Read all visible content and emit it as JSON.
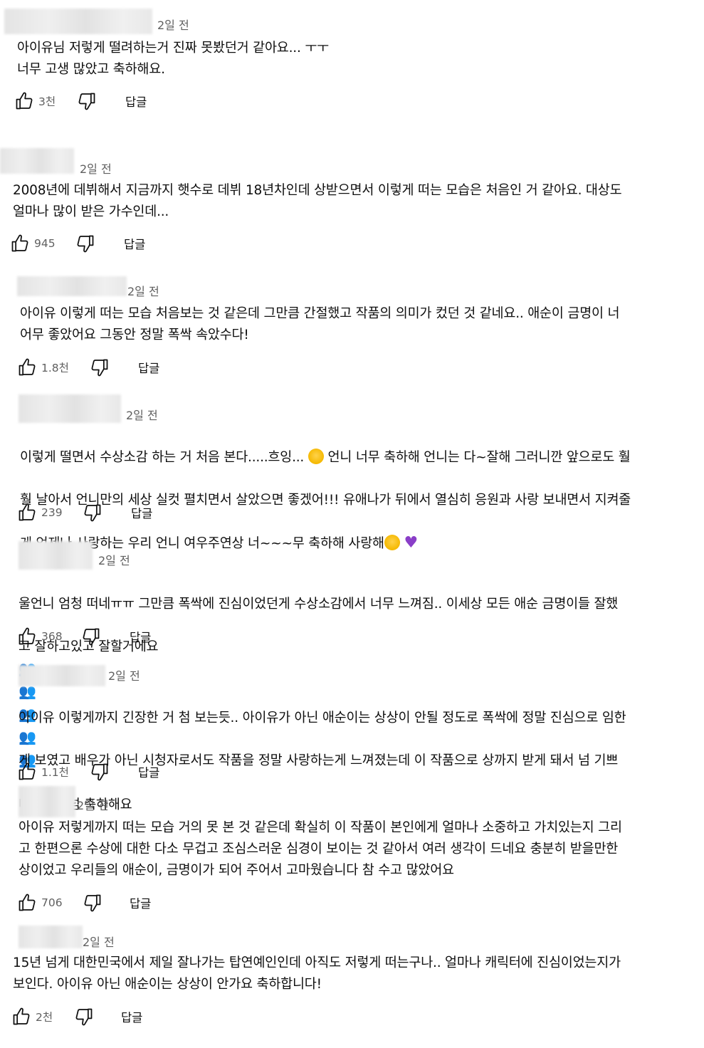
{
  "comments": [
    {
      "time": "2일 전",
      "text": "아이유님 저렇게 떨려하는거 진짜 못봤던거 같아요... ㅜㅜ\n너무 고생 많았고 축하해요.",
      "likes": "3천",
      "reply": "답글"
    },
    {
      "time": "2일 전",
      "text": "2008년에 데뷔해서 지금까지 햇수로 데뷔 18년차인데 상받으면서 이렇게 떠는 모습은 처음인 거 같아요. 대상도\n얼마나 많이 받은 가수인데...",
      "likes": "945",
      "reply": "답글"
    },
    {
      "time": "2일 전",
      "text": "아이유 이렇게 떠는 모습 처음보는 것 같은데 그만큼 간절했고 작품의 의미가 컸던 것 같네요.. 애순이 금명이 너\n어무 좋았어요 그동안 정말 폭싹 속았수다!",
      "likes": "1.8천",
      "reply": "답글"
    },
    {
      "time": "2일 전",
      "text_lines": [
        "이렇게 떨면서 수상소감 하는 거 처음 본다.....흐잉...",
        "언니 너무 축하해 언니는 다~잘해 그러니깐 앞으로도 훨",
        "훨 날아서 언니만의 세상 실컷 펼치면서 살았으면 좋겠어!!! 유애나가 뒤에서 열심히 응원과 사랑 보내면서 지켜줄",
        "게 언제나 사랑하는 우리 언니 여우주연상 너~~~무 축하해 사랑해"
      ],
      "likes": "239",
      "reply": "답글"
    },
    {
      "time": "2일 전",
      "text_lines": [
        "울언니 엄청 떠네ㅠㅠ 그만큼 폭싹에 진심이었던게 수상소감에서 너무 느껴짐.. 이세상 모든 애순 금명이들 잘했",
        "고 잘하고있고 잘할거에요"
      ],
      "likes": "368",
      "reply": "답글"
    },
    {
      "time": "2일 전",
      "text_lines": [
        "아이유 이렇게까지 긴장한 거 첨 보는듯.. 아이유가 아닌 애순이는 상상이 안될 정도로 폭싹에 정말 진심으로 임한",
        "게 보였고 배우가 아닌 시청자로서도 작품을 정말 사랑하는게 느껴졌는데 이 작품으로 상까지 받게 돼서 넘 기쁘",
        "다",
        "넘넘 축하해요"
      ],
      "likes": "1.1천",
      "reply": "답글"
    },
    {
      "time": "2일 전",
      "text": "아이유 저렇게까지 떠는 모습 거의 못 본 것 같은데 확실히 이 작품이 본인에게 얼마나 소중하고 가치있는지 그리\n고 한편으론 수상에 대한 다소 무겁고 조심스러운 심경이 보이는 것 같아서 여러 생각이 드네요 충분히 받을만한\n상이었고 우리들의 애순이, 금명이가 되어 주어서 고마웠습니다 참 수고 많았어요",
      "likes": "706",
      "reply": "답글"
    },
    {
      "time": "2일 전",
      "text": "15년 넘게 대한민국에서 제일 잘나가는 탑연예인인데 아직도 저렇게 떠는구나.. 얼마나 캐릭터에 진심이었는지가\n보인다. 아이유 아닌 애순이는 상상이 안가요 축하합니다!",
      "likes": "2천",
      "reply": "답글"
    }
  ],
  "icons": {
    "like": "thumbs-up-icon",
    "dislike": "thumbs-down-icon"
  },
  "colors": {
    "text": "#0f0f0f",
    "meta": "#606060"
  }
}
